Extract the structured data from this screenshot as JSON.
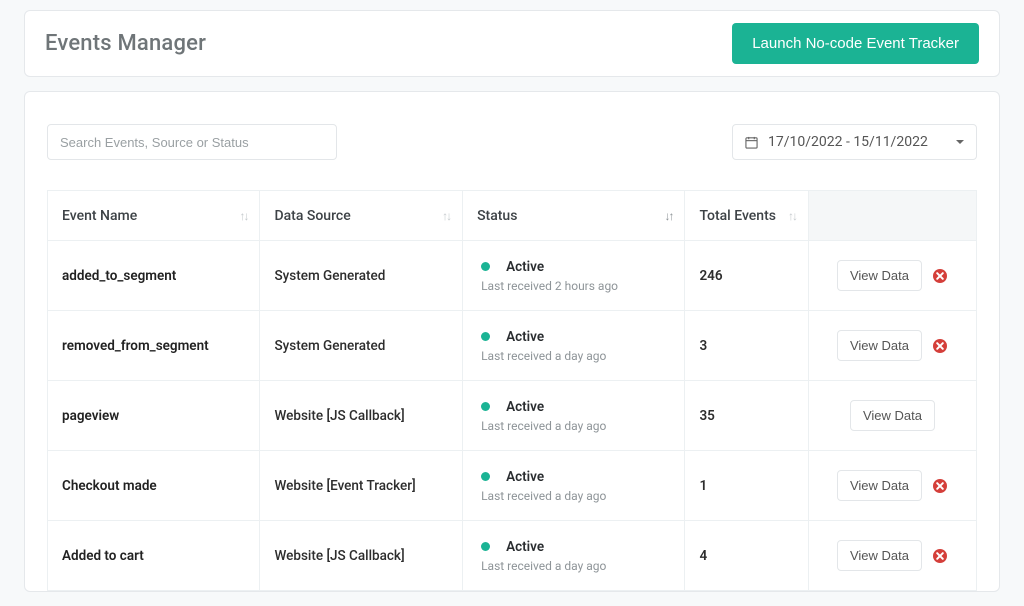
{
  "header": {
    "title": "Events Manager",
    "launch_button": "Launch No-code Event Tracker"
  },
  "filters": {
    "search_placeholder": "Search Events, Source or Status",
    "date_range": "17/10/2022 - 15/11/2022"
  },
  "table": {
    "columns": {
      "event_name": "Event Name",
      "data_source": "Data Source",
      "status": "Status",
      "total_events": "Total Events"
    },
    "view_label": "View Data",
    "rows": [
      {
        "name": "added_to_segment",
        "source": "System Generated",
        "status": "Active",
        "last_received": "Last received 2 hours ago",
        "total": "246",
        "deletable": true
      },
      {
        "name": "removed_from_segment",
        "source": "System Generated",
        "status": "Active",
        "last_received": "Last received a day ago",
        "total": "3",
        "deletable": true
      },
      {
        "name": "pageview",
        "source": "Website [JS Callback]",
        "status": "Active",
        "last_received": "Last received a day ago",
        "total": "35",
        "deletable": false
      },
      {
        "name": "Checkout made",
        "source": "Website [Event Tracker]",
        "status": "Active",
        "last_received": "Last received a day ago",
        "total": "1",
        "deletable": true
      },
      {
        "name": "Added to cart",
        "source": "Website [JS Callback]",
        "status": "Active",
        "last_received": "Last received a day ago",
        "total": "4",
        "deletable": true
      }
    ]
  },
  "colors": {
    "accent": "#1bb394",
    "danger": "#d43f3a"
  }
}
